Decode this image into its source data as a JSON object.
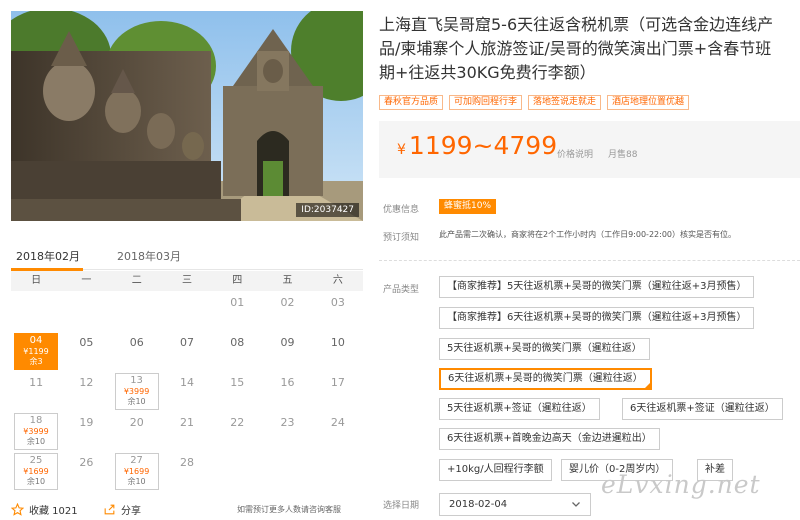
{
  "photo": {
    "id_label": "ID:2037427"
  },
  "calendar": {
    "months": [
      "2018年02月",
      "2018年03月"
    ],
    "weekdays": [
      "日",
      "一",
      "二",
      "三",
      "四",
      "五",
      "六"
    ],
    "days": {
      "d01": "01",
      "d02": "02",
      "d03": "03",
      "d05": "05",
      "d06": "06",
      "d07": "07",
      "d08": "08",
      "d09": "09",
      "d10": "10",
      "d11": "11",
      "d12": "12",
      "d14": "14",
      "d15": "15",
      "d16": "16",
      "d17": "17",
      "d19": "19",
      "d20": "20",
      "d21": "21",
      "d22": "22",
      "d23": "23",
      "d24": "24",
      "d26": "26",
      "d28": "28"
    },
    "available": {
      "d04": {
        "day": "04",
        "price": "¥1199",
        "remain": "余3"
      },
      "d13": {
        "day": "13",
        "price": "¥3999",
        "remain": "余10"
      },
      "d18": {
        "day": "18",
        "price": "¥3999",
        "remain": "余10"
      },
      "d25": {
        "day": "25",
        "price": "¥1699",
        "remain": "余10"
      },
      "d27": {
        "day": "27",
        "price": "¥1699",
        "remain": "余10"
      }
    }
  },
  "footer": {
    "favorite_label": "收藏 1021",
    "share_label": "分享",
    "note": "如需预订更多人数请咨询客服"
  },
  "product": {
    "title_lines": [
      "上海直飞吴哥窟5-6天往返含税机票（可选含金边连线产",
      "品/柬埔寨个人旅游签证/吴哥的微笑演出门票+含春节班",
      "期+往返共30KG免费行李额）"
    ],
    "tags": [
      "春秋官方品质",
      "可加购回程行李",
      "落地签说走就走",
      "酒店地理位置优越"
    ],
    "price": {
      "currency": "¥",
      "range": "1199~4799",
      "note": "价格说明",
      "sales": "月售88"
    },
    "promo_label": "优惠信息",
    "promo_badge": "蜂蜜抵10%",
    "notice_label": "预订须知",
    "notice_text": "此产品需二次确认，商家将在2个工作小时内（工作日9:00-22:00）核实是否有位。",
    "type_label": "产品类型",
    "options": [
      "【商家推荐】5天往返机票+吴哥的微笑门票（暹粒往返+3月预售）",
      "【商家推荐】6天往返机票+吴哥的微笑门票（暹粒往返+3月预售）",
      "5天往返机票+吴哥的微笑门票（暹粒往返）",
      "6天往返机票+吴哥的微笑门票（暹粒往返）",
      "5天往返机票+签证（暹粒往返）",
      "6天往返机票+签证（暹粒往返）",
      "6天往返机票+首晚金边高天（金边进暹粒出）",
      "+10kg/人回程行李额",
      "婴儿价（0-2周岁内）",
      "补差"
    ],
    "selected_option": "6天往返机票+吴哥的微笑门票（暹粒往返）",
    "date_label": "选择日期",
    "date_value": "2018-02-04"
  },
  "watermark": "eLvxing.net",
  "colors": {
    "accent": "#ff8a00",
    "price": "#ff6600"
  },
  "icons": {
    "favorite": "star-icon",
    "share": "share-icon",
    "dropdown": "chevron-down-icon"
  }
}
